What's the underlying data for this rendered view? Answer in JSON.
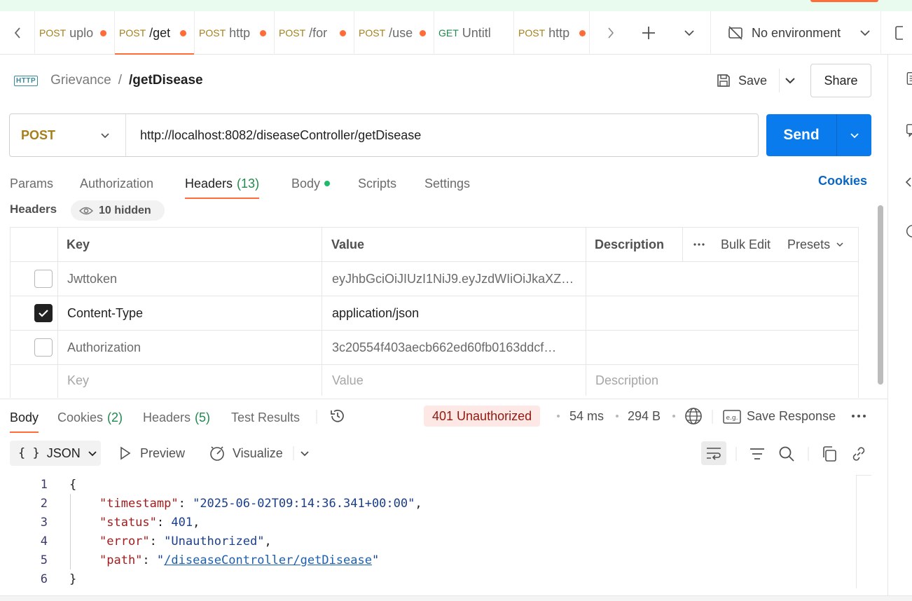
{
  "tabs": [
    {
      "method": "POST",
      "name": "uplo",
      "dot": true,
      "active": false
    },
    {
      "method": "POST",
      "name": "/get",
      "dot": true,
      "active": true
    },
    {
      "method": "POST",
      "name": "http",
      "dot": true,
      "active": false
    },
    {
      "method": "POST",
      "name": "/for",
      "dot": true,
      "active": false
    },
    {
      "method": "POST",
      "name": "/use",
      "dot": true,
      "active": false
    },
    {
      "method": "GET",
      "name": "Untitl",
      "dot": false,
      "active": false
    },
    {
      "method": "POST",
      "name": "http",
      "dot": true,
      "active": false
    }
  ],
  "environment": {
    "label": "No environment"
  },
  "breadcrumb": {
    "badge": "HTTP",
    "collection": "Grievance",
    "separator": "/",
    "request": "/getDisease"
  },
  "actions": {
    "save": "Save",
    "share": "Share"
  },
  "request": {
    "method": "POST",
    "url": "http://localhost:8082/diseaseController/getDisease",
    "send": "Send"
  },
  "request_tabs": {
    "params": "Params",
    "authorization": "Authorization",
    "headers": "Headers",
    "headers_count": "(13)",
    "body": "Body",
    "scripts": "Scripts",
    "settings": "Settings",
    "cookies": "Cookies"
  },
  "headers_section": {
    "label": "Headers",
    "hidden": "10 hidden"
  },
  "headers_table": {
    "columns": {
      "key": "Key",
      "value": "Value",
      "description": "Description"
    },
    "bulk_edit": "Bulk Edit",
    "presets": "Presets",
    "rows": [
      {
        "checked": false,
        "key": "Jwttoken",
        "value": "eyJhbGciOiJIUzI1NiJ9.eyJzdWIiOiJkaXZ…",
        "description": ""
      },
      {
        "checked": true,
        "key": "Content-Type",
        "value": "application/json",
        "description": ""
      },
      {
        "checked": false,
        "key": "Authorization",
        "value": "3c20554f403aecb662ed60fb0163ddcf…",
        "description": ""
      }
    ],
    "placeholder": {
      "key": "Key",
      "value": "Value",
      "description": "Description"
    }
  },
  "response_tabs": {
    "body": "Body",
    "cookies": "Cookies",
    "cookies_count": "(2)",
    "headers": "Headers",
    "headers_count": "(5)",
    "test_results": "Test Results"
  },
  "response_meta": {
    "status": "401 Unauthorized",
    "time": "54 ms",
    "size": "294 B",
    "save_response": "Save Response",
    "status_color": "#8e1a10"
  },
  "response_toolbar": {
    "format": "JSON",
    "preview": "Preview",
    "visualize": "Visualize"
  },
  "response_body": {
    "line_numbers": [
      "1",
      "2",
      "3",
      "4",
      "5",
      "6"
    ],
    "open": "{",
    "close": "}",
    "timestamp_key": "\"timestamp\"",
    "timestamp_val": "\"2025-06-02T09:14:36.341+00:00\"",
    "status_key": "\"status\"",
    "status_val": "401",
    "error_key": "\"error\"",
    "error_val": "\"Unauthorized\"",
    "path_key": "\"path\"",
    "path_val": "/diseaseController/getDisease"
  },
  "colors": {
    "accent": "#ff6c37",
    "send": "#097bed",
    "post": "#a57f1a",
    "get": "#1f8a4d",
    "link": "#0a66c2"
  }
}
